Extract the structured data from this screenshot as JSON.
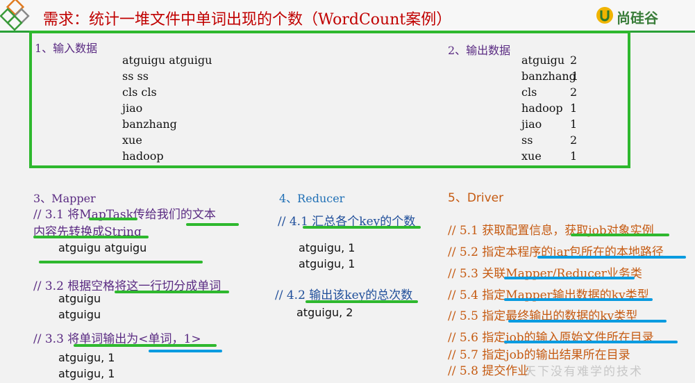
{
  "header": {
    "title": "需求：统计一堆文件中单词出现的个数（WordCount案例）",
    "logo_text": "尚硅谷"
  },
  "input_section": {
    "label": "1、输入数据",
    "lines": [
      "atguigu atguigu",
      "ss ss",
      "cls cls",
      "jiao",
      "banzhang",
      "xue",
      "hadoop"
    ]
  },
  "output_section": {
    "label": "2、输出数据",
    "rows": [
      {
        "word": "atguigu",
        "count": "2"
      },
      {
        "word": "banzhang",
        "count": "1"
      },
      {
        "word": "cls",
        "count": "2"
      },
      {
        "word": "hadoop",
        "count": "1"
      },
      {
        "word": "jiao",
        "count": "1"
      },
      {
        "word": "ss",
        "count": "2"
      },
      {
        "word": "xue",
        "count": "1"
      }
    ]
  },
  "mapper": {
    "label": "3、Mapper",
    "s31_line1": "//  3.1  将MapTask传给我们的文本",
    "s31_line2": "内容先转换成String",
    "s31_out": "atguigu atguigu",
    "s32": "// 3.2 根据空格将这一行切分成单词",
    "s32_out1": "atguigu",
    "s32_out2": "atguigu",
    "s33": "// 3.3 将单词输出为<单词，1>",
    "s33_out1": "atguigu, 1",
    "s33_out2": "atguigu, 1"
  },
  "reducer": {
    "label": "4、Reducer",
    "s41": "// 4.1 汇总各个key的个数",
    "s41_out1": "atguigu, 1",
    "s41_out2": "atguigu, 1",
    "s42": "// 4.2  输出该key的总次数",
    "s42_out": "atguigu, 2"
  },
  "driver": {
    "label": "5、Driver",
    "steps": [
      "// 5.1 获取配置信息，获取job对象实例",
      "// 5.2 指定本程序的jar包所在的本地路径",
      "// 5.3 关联Mapper/Reducer业务类",
      "// 5.4 指定Mapper输出数据的kv类型",
      "// 5.5 指定最终输出的数据的kv类型",
      "// 5.6 指定job的输入原始文件所在目录",
      "// 5.7  指定job的输出结果所在目录",
      "// 5.8 提交作业"
    ]
  },
  "watermark": "天下没有难学的技术",
  "colors": {
    "title": "#c00000",
    "accent_green": "#2eb82e",
    "underline_blue": "#0a9be0",
    "section_purple": "#5a2b82",
    "driver_orange": "#c55a11"
  }
}
